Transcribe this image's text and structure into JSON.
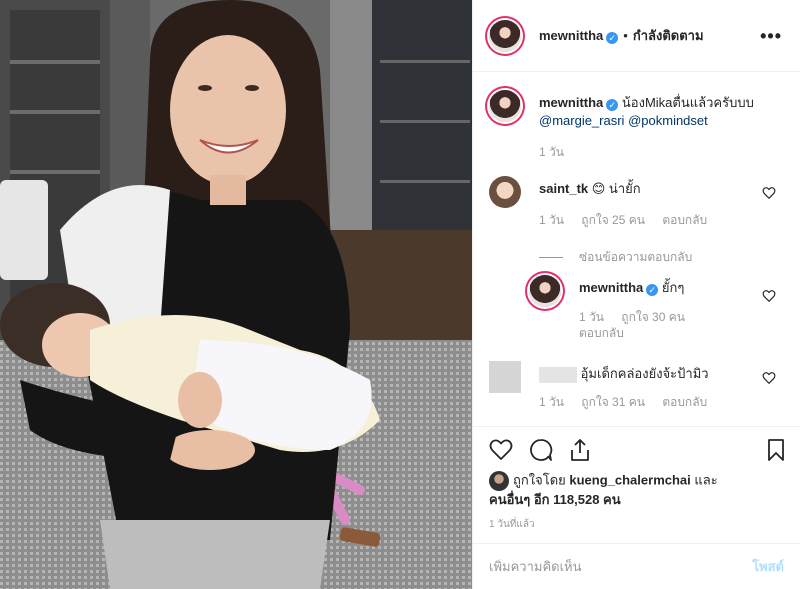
{
  "post": {
    "username": "mewnittha",
    "follow_status": "กำลังติดตาม",
    "dot": "•",
    "more": "•••"
  },
  "comments": [
    {
      "username": "mewnittha",
      "text": "น้องMikaตื่นแล้วครับบบ",
      "mentions": [
        "@margie_rasri",
        "@pokmindset"
      ],
      "time": "1 วัน"
    },
    {
      "username": "saint_tk",
      "text": "😊 น่ายั้ก",
      "time": "1 วัน",
      "likes": "ถูกใจ 25 คน",
      "reply": "ตอบกลับ"
    },
    {
      "username": "mewnittha",
      "text": "ยั้กๆ",
      "time": "1 วัน",
      "likes": "ถูกใจ 30 คน",
      "reply": "ตอบกลับ",
      "is_reply": true
    },
    {
      "username": "",
      "text": "อุ้มเด็กคล่องยังจ้ะป้ามิว",
      "time": "1 วัน",
      "likes": "ถูกใจ 31 คน",
      "reply": "ตอบกลับ"
    }
  ],
  "hide_replies": "ซ่อนข้อความตอบกลับ",
  "likes_line": {
    "prefix": "ถูกใจโดย",
    "user": "kueng_chalermchai",
    "and": "และ",
    "others": "คนอื่นๆ อีก 118,528 คน"
  },
  "timestamp": "1 วันที่แล้ว",
  "add_comment": {
    "placeholder": "เพิ่มความคิดเห็น",
    "post_label": "โพสต์"
  },
  "icons": [
    "heart-icon",
    "comment-icon",
    "share-icon",
    "bookmark-icon",
    "more-icon",
    "verified-icon"
  ],
  "colors": {
    "verified": "#3897f0",
    "story_ring": "#e1306c",
    "post_button": "#b2dffc",
    "meta": "#999999"
  }
}
